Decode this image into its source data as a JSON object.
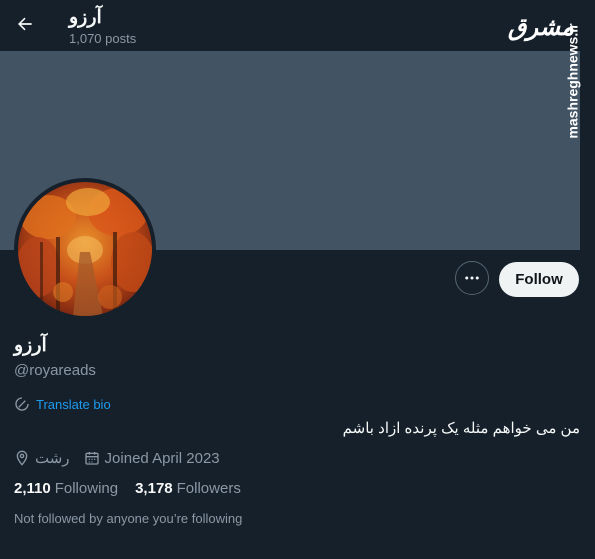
{
  "header": {
    "name": "آرزو",
    "posts": "1,070 posts"
  },
  "watermark": {
    "logo": "مشرق",
    "site": "mashreghnews.ir"
  },
  "profile": {
    "display_name": "آرزو",
    "handle": "@royareads",
    "translate_label": "Translate bio",
    "bio": "من می خواهم مثله یک پرنده ازاد باشم",
    "location": "رشت",
    "joined": "Joined April 2023",
    "following_count": "2,110",
    "following_label": "Following",
    "followers_count": "3,178",
    "followers_label": "Followers",
    "not_followed": "Not followed by anyone you’re following"
  },
  "actions": {
    "follow_label": "Follow"
  },
  "colors": {
    "background": "#15202b",
    "banner": "#425364",
    "accent": "#1d9bf0",
    "secondary_text": "#8b98a5",
    "follow_button": "#eff3f4"
  }
}
